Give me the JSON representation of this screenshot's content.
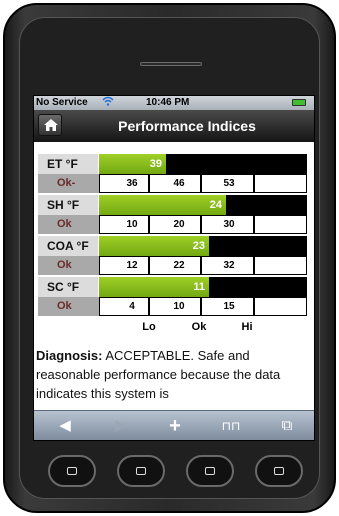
{
  "status_bar": {
    "carrier": "No Service",
    "wifi_icon": "wifi-icon",
    "time": "10:46 PM",
    "battery_color": "#3fbf2f"
  },
  "nav_bar": {
    "home_icon": "home-icon",
    "title": "Performance Indices"
  },
  "gauges": [
    {
      "label": "ET °F",
      "status": "Ok-",
      "value": "39",
      "fill_fraction": 0.32,
      "ticks": [
        "36",
        "46",
        "53"
      ]
    },
    {
      "label": "SH °F",
      "status": "Ok",
      "value": "24",
      "fill_fraction": 0.61,
      "ticks": [
        "10",
        "20",
        "30"
      ]
    },
    {
      "label": "COA °F",
      "status": "Ok",
      "value": "23",
      "fill_fraction": 0.53,
      "ticks": [
        "12",
        "22",
        "32"
      ]
    },
    {
      "label": "SC °F",
      "status": "Ok",
      "value": "11",
      "fill_fraction": 0.53,
      "ticks": [
        "4",
        "10",
        "15"
      ]
    }
  ],
  "levels": {
    "lo": "Lo",
    "ok": "Ok",
    "hi": "Hi"
  },
  "diagnosis": {
    "heading": "Diagnosis:",
    "text": "ACCEPTABLE. Safe and reasonable performance because the data indicates this system is"
  },
  "toolbar": {
    "back_glyph": "◀",
    "forward_glyph": "▶",
    "add_glyph": "+",
    "bookmarks_glyph": "⊓⊓",
    "pages_glyph": "⧉"
  },
  "colors": {
    "fill_green": "#8cc21e",
    "bar_black": "#000000",
    "status_text": "#6b2a2a"
  }
}
